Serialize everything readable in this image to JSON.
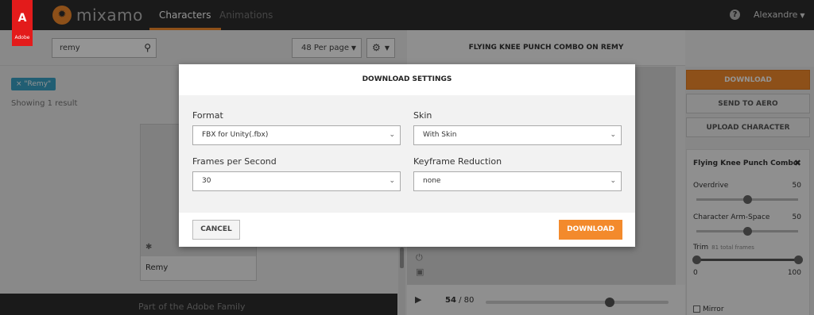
{
  "header": {
    "adobe_label": "Adobe",
    "logo_text": "mixamo",
    "tabs": [
      "Characters",
      "Animations"
    ],
    "user_name": "Alexandre"
  },
  "left": {
    "search_value": "remy",
    "per_page": "48 Per page",
    "filter_chip": "× \"Remy\"",
    "result_count": "Showing 1 result",
    "character_name": "Remy",
    "footer_text": "Part of the Adobe Family"
  },
  "right": {
    "animation_title": "FLYING KNEE PUNCH COMBO ON REMY",
    "download_button": "DOWNLOAD",
    "send_to_aero": "SEND TO AERO",
    "upload_character": "UPLOAD CHARACTER",
    "frame_current": "54",
    "frame_total": "/ 80",
    "timeline_position": 0.68,
    "settings": {
      "title": "Flying Knee Punch Combo",
      "overdrive_label": "Overdrive",
      "overdrive_value": "50",
      "overdrive_level": 0.5,
      "armspace_label": "Character Arm-Space",
      "armspace_value": "50",
      "armspace_level": 0.5,
      "trim_label": "Trim",
      "trim_frames": "81 total frames",
      "trim_min": "0",
      "trim_max": "100",
      "mirror_label": "Mirror"
    }
  },
  "modal": {
    "title": "DOWNLOAD SETTINGS",
    "format_label": "Format",
    "format_value": "FBX for Unity(.fbx)",
    "skin_label": "Skin",
    "skin_value": "With Skin",
    "fps_label": "Frames per Second",
    "fps_value": "30",
    "keyframe_label": "Keyframe Reduction",
    "keyframe_value": "none",
    "cancel_label": "CANCEL",
    "download_label": "DOWNLOAD"
  },
  "colors": {
    "accent": "#f38a2c",
    "topbar": "#2e2e2e",
    "chip": "#3aa3c7",
    "adobe_red": "#e31b1b"
  }
}
